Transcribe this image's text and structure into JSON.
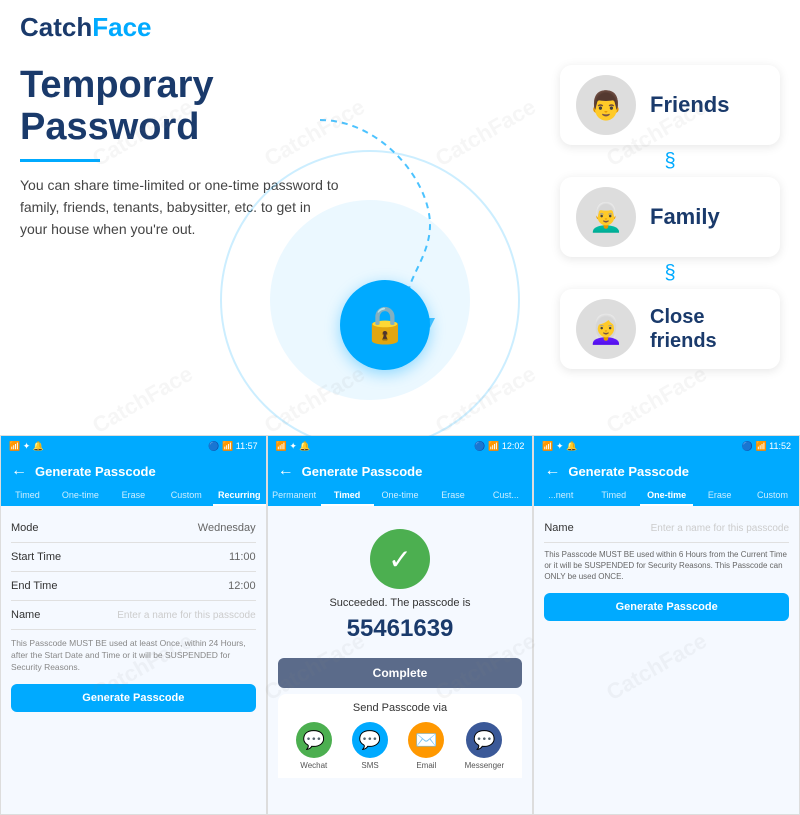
{
  "logo": {
    "catch": "Catch",
    "face": "Face"
  },
  "header_title": "Temporary Password",
  "description": "You can share time-limited or one-time password to family, friends, tenants, babysitter, etc. to get in your house when you're out.",
  "people": [
    {
      "name": "Friends",
      "emoji": "👨"
    },
    {
      "name": "Family",
      "emoji": "👨‍🦳"
    },
    {
      "name": "Close friends",
      "emoji": "👩‍🦳"
    }
  ],
  "phones": [
    {
      "id": "phone1",
      "status_left": "📶 ✦ 🔔 📡",
      "status_time": "11:57",
      "header_title": "Generate Passcode",
      "tabs": [
        "Timed",
        "One-time",
        "Erase",
        "Custom",
        "Recurring"
      ],
      "active_tab": "Recurring",
      "form": [
        {
          "label": "Mode",
          "value": "Wednesday"
        },
        {
          "label": "Start Time",
          "value": "11:00"
        },
        {
          "label": "End Time",
          "value": "12:00"
        },
        {
          "label": "Name",
          "value": "",
          "placeholder": "Enter a name for this passcode"
        }
      ],
      "note": "This Passcode MUST BE used at least Once, within 24 Hours, after the Start Date and Time or it will be SUSPENDED for Security Reasons.",
      "button": "Generate Passcode"
    },
    {
      "id": "phone2",
      "status_left": "📶 ✦ 🔔 📡",
      "status_time": "12:02",
      "header_title": "Generate Passcode",
      "tabs": [
        "Permanent",
        "Timed",
        "One-time",
        "Erase",
        "Cust..."
      ],
      "active_tab": "Timed",
      "success_text": "Succeeded. The passcode is",
      "passcode": "55461639",
      "complete_btn": "Complete",
      "share_title": "Send Passcode via",
      "share_items": [
        {
          "label": "Wechat",
          "color": "#4caf50",
          "icon": "💬"
        },
        {
          "label": "SMS",
          "color": "#00aaff",
          "icon": "💬"
        },
        {
          "label": "Email",
          "color": "#ff9800",
          "icon": "✉️"
        },
        {
          "label": "Messenger",
          "color": "#3b5998",
          "icon": "💬"
        }
      ]
    },
    {
      "id": "phone3",
      "status_left": "📶 ✦ 🔔 📡",
      "status_time": "11:52",
      "header_title": "Generate Passcode",
      "tabs": [
        "...nent",
        "Timed",
        "One-time",
        "Erase",
        "Custom"
      ],
      "active_tab": "One-time",
      "form": [
        {
          "label": "Name",
          "value": "",
          "placeholder": "Enter a name for this passcode"
        }
      ],
      "note": "This Passcode MUST BE used within 6 Hours from the Current Time or it will be SUSPENDED for Security Reasons. This Passcode can ONLY be used ONCE.",
      "button": "Generate Passcode"
    }
  ]
}
